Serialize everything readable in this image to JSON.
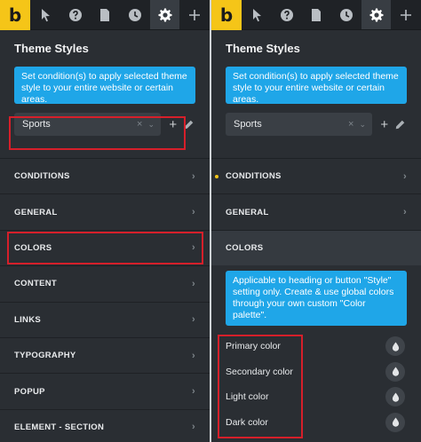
{
  "app": {
    "logo_letter": "b"
  },
  "toolbar": {
    "icons": [
      "cursor-icon",
      "help-icon",
      "document-icon",
      "history-icon",
      "gear-icon",
      "plus-icon"
    ],
    "active": "gear-icon"
  },
  "left": {
    "title": "Theme Styles",
    "info": "Set condition(s) to apply selected theme style to your entire website or certain areas.",
    "select": {
      "value": "Sports",
      "clear": "×",
      "chevron": "⌄"
    },
    "add": "+",
    "sections": [
      "CONDITIONS",
      "GENERAL",
      "COLORS",
      "CONTENT",
      "LINKS",
      "TYPOGRAPHY",
      "POPUP",
      "ELEMENT - SECTION"
    ]
  },
  "right": {
    "title": "Theme Styles",
    "info": "Set condition(s) to apply selected theme style to your entire website or certain areas.",
    "select": {
      "value": "Sports",
      "clear": "×",
      "chevron": "⌄"
    },
    "add": "+",
    "sections": [
      "CONDITIONS",
      "GENERAL",
      "COLORS"
    ],
    "colors_info": "Applicable to heading or button \"Style\" setting only. Create & use global colors through your own custom \"Color palette\".",
    "color_rows": [
      "Primary color",
      "Secondary color",
      "Light color",
      "Dark color"
    ]
  },
  "colors": {
    "accent": "#f5c518",
    "info_bg": "#1fa6e8",
    "highlight": "#d61f2a",
    "panel_bg": "#2a2e33"
  }
}
